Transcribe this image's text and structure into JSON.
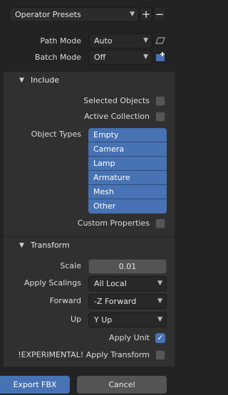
{
  "operator_presets": {
    "label": "Operator Presets"
  },
  "path_mode": {
    "label": "Path Mode",
    "value": "Auto"
  },
  "batch_mode": {
    "label": "Batch Mode",
    "value": "Off"
  },
  "include": {
    "title": "Include",
    "selected_objects": "Selected Objects",
    "active_collection": "Active Collection",
    "object_types_label": "Object Types",
    "object_types": [
      "Empty",
      "Camera",
      "Lamp",
      "Armature",
      "Mesh",
      "Other"
    ],
    "custom_properties": "Custom Properties"
  },
  "transform": {
    "title": "Transform",
    "scale_label": "Scale",
    "scale_value": "0.01",
    "apply_scalings_label": "Apply Scalings",
    "apply_scalings_value": "All Local",
    "forward_label": "Forward",
    "forward_value": "-Z Forward",
    "up_label": "Up",
    "up_value": "Y Up",
    "apply_unit": "Apply Unit",
    "apply_unit_checked": true,
    "apply_transform": "!EXPERIMENTAL! Apply Transform"
  },
  "footer": {
    "export_label": "Export FBX",
    "cancel_label": "Cancel"
  },
  "colors": {
    "accent": "#4772b3",
    "panel": "#303030",
    "background": "#232323"
  }
}
